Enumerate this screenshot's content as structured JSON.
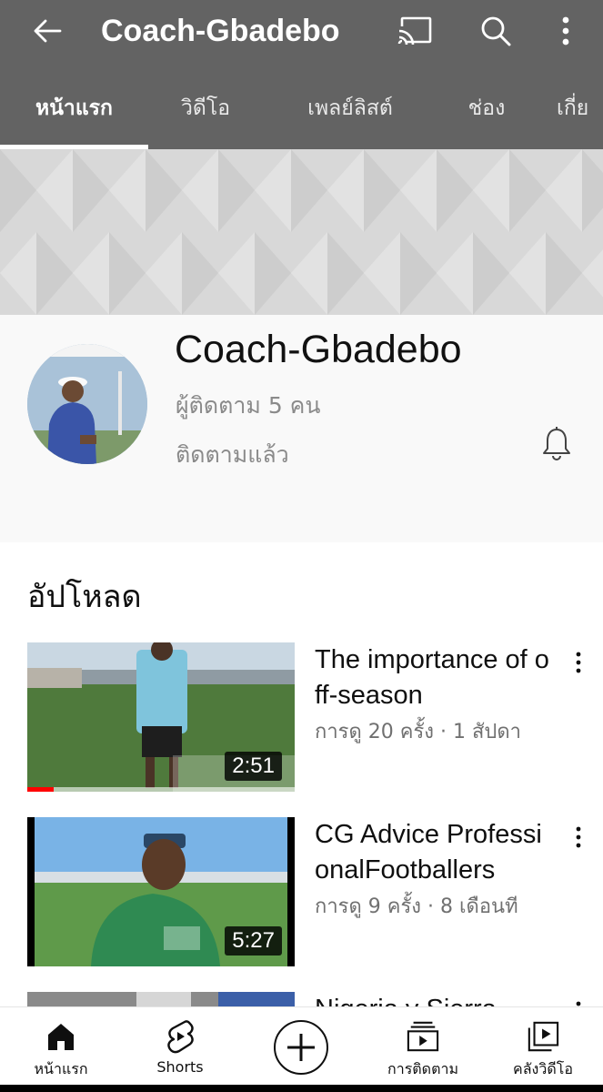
{
  "app_bar": {
    "title": "Coach-Gbadebo",
    "background": "#636363",
    "icons": [
      "back-arrow-icon",
      "cast-icon",
      "search-icon",
      "more-vert-icon"
    ]
  },
  "tabs": [
    {
      "label": "หน้าแรก",
      "active": true
    },
    {
      "label": "วิดีโอ",
      "active": false
    },
    {
      "label": "เพลย์ลิสต์",
      "active": false
    },
    {
      "label": "ช่อง",
      "active": false
    },
    {
      "label": "เกี่ย",
      "active": false
    }
  ],
  "channel": {
    "name": "Coach-Gbadebo",
    "subscribers": "ผู้ติดตาม 5 คน",
    "subscribed_label": "ติดตามแล้ว",
    "notification_icon": "bell-icon"
  },
  "uploads": {
    "title": "อัปโหลด",
    "videos": [
      {
        "title": "The importance of off-season",
        "meta": "การดู 20 ครั้ง · 1 สัปดา",
        "duration": "2:51",
        "watched_fraction": 0.1
      },
      {
        "title": "CG Advice ProfessionalFootballers",
        "meta": "การดู 9 ครั้ง · 8 เดือนที",
        "duration": "5:27",
        "watched_fraction": 0
      },
      {
        "title": "Nigeria v Sierra",
        "meta": "",
        "duration": "",
        "watched_fraction": 0
      }
    ]
  },
  "bottom_nav": [
    {
      "label": "หน้าแรก",
      "icon": "home-icon",
      "active": true
    },
    {
      "label": "Shorts",
      "icon": "shorts-icon",
      "active": false
    },
    {
      "label": "",
      "icon": "create-plus-icon",
      "active": false
    },
    {
      "label": "การติดตาม",
      "icon": "subscriptions-icon",
      "active": false
    },
    {
      "label": "คลังวิดีโอ",
      "icon": "library-icon",
      "active": false
    }
  ],
  "colors": {
    "accent_progress": "#ff0000",
    "banner": "#d9d9d9",
    "secondary_text": "#8a8a8a"
  }
}
